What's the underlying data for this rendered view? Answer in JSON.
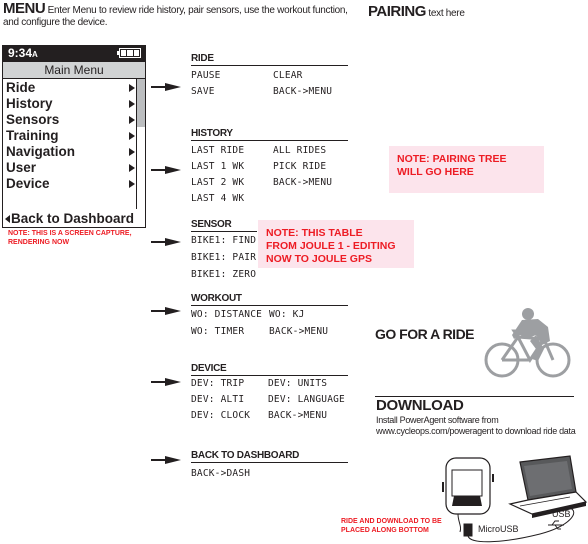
{
  "intro": {
    "heading": "MENU",
    "text": "Enter Menu to review ride history, pair sensors, use the workout function, and configure the device."
  },
  "pairing": {
    "heading": "PAIRING",
    "text": "text here"
  },
  "device_screen": {
    "time": "9:34",
    "time_suffix": "A",
    "battery_icon": "battery-full-icon",
    "title": "Main Menu",
    "items": [
      {
        "label": "Ride"
      },
      {
        "label": "History"
      },
      {
        "label": "Sensors"
      },
      {
        "label": "Training"
      },
      {
        "label": "Navigation"
      },
      {
        "label": "User"
      },
      {
        "label": "Device"
      }
    ],
    "back_label": "Back to Dashboard",
    "scrollbar_position": 0.37
  },
  "notes": {
    "screen_capture": "NOTE: THIS IS A SCREEN CAPTURE, RENDERING NOW",
    "screen_capture_l1": "NOTE: THIS IS A SCREEN CAPTURE,",
    "screen_capture_l2": "RENDERING NOW",
    "table_l1": "NOTE: THIS TABLE",
    "table_l2": "FROM JOULE 1 - EDITING",
    "table_l3": "NOW TO JOULE GPS",
    "pairing_l1": "NOTE: PAIRING TREE",
    "pairing_l2": "WILL GO HERE",
    "bottom_l1": "RIDE AND DOWNLOAD TO BE",
    "bottom_l2": "PLACED ALONG BOTTOM"
  },
  "sections": {
    "ride": {
      "title": "RIDE",
      "rows": [
        [
          "PAUSE",
          "CLEAR"
        ],
        [
          "SAVE",
          "BACK->MENU"
        ]
      ]
    },
    "history": {
      "title": "HISTORY",
      "rows": [
        [
          "LAST RIDE",
          "ALL RIDES"
        ],
        [
          "LAST 1 WK",
          "PICK RIDE"
        ],
        [
          "LAST 2 WK",
          "BACK->MENU"
        ],
        [
          "LAST 4 WK",
          ""
        ]
      ]
    },
    "sensor": {
      "title": "SENSOR",
      "rows": [
        [
          "BIKE1: FIND",
          ""
        ],
        [
          "BIKE1: PAIR",
          ""
        ],
        [
          "BIKE1: ZERO",
          ""
        ]
      ]
    },
    "workout": {
      "title": "WORKOUT",
      "rows": [
        [
          "WO: DISTANCE",
          "WO: KJ"
        ],
        [
          "WO: TIMER",
          "BACK->MENU"
        ]
      ]
    },
    "device": {
      "title": "DEVICE",
      "rows": [
        [
          "DEV: TRIP",
          "DEV: UNITS"
        ],
        [
          "DEV: ALTI",
          "DEV: LANGUAGE"
        ],
        [
          "DEV: CLOCK",
          "BACK->MENU"
        ]
      ]
    },
    "back": {
      "title": "BACK TO DASHBOARD",
      "rows": [
        [
          "BACK->DASH",
          ""
        ]
      ]
    }
  },
  "go_ride": {
    "heading": "GO FOR A RIDE",
    "icon": "cyclist-icon"
  },
  "download": {
    "heading": "DOWNLOAD",
    "line1": "Install PowerAgent software from",
    "line2": "www.cycleops.com/poweragent to download ride data",
    "usb_label": "USB",
    "microusb_label": "MicroUSB"
  }
}
